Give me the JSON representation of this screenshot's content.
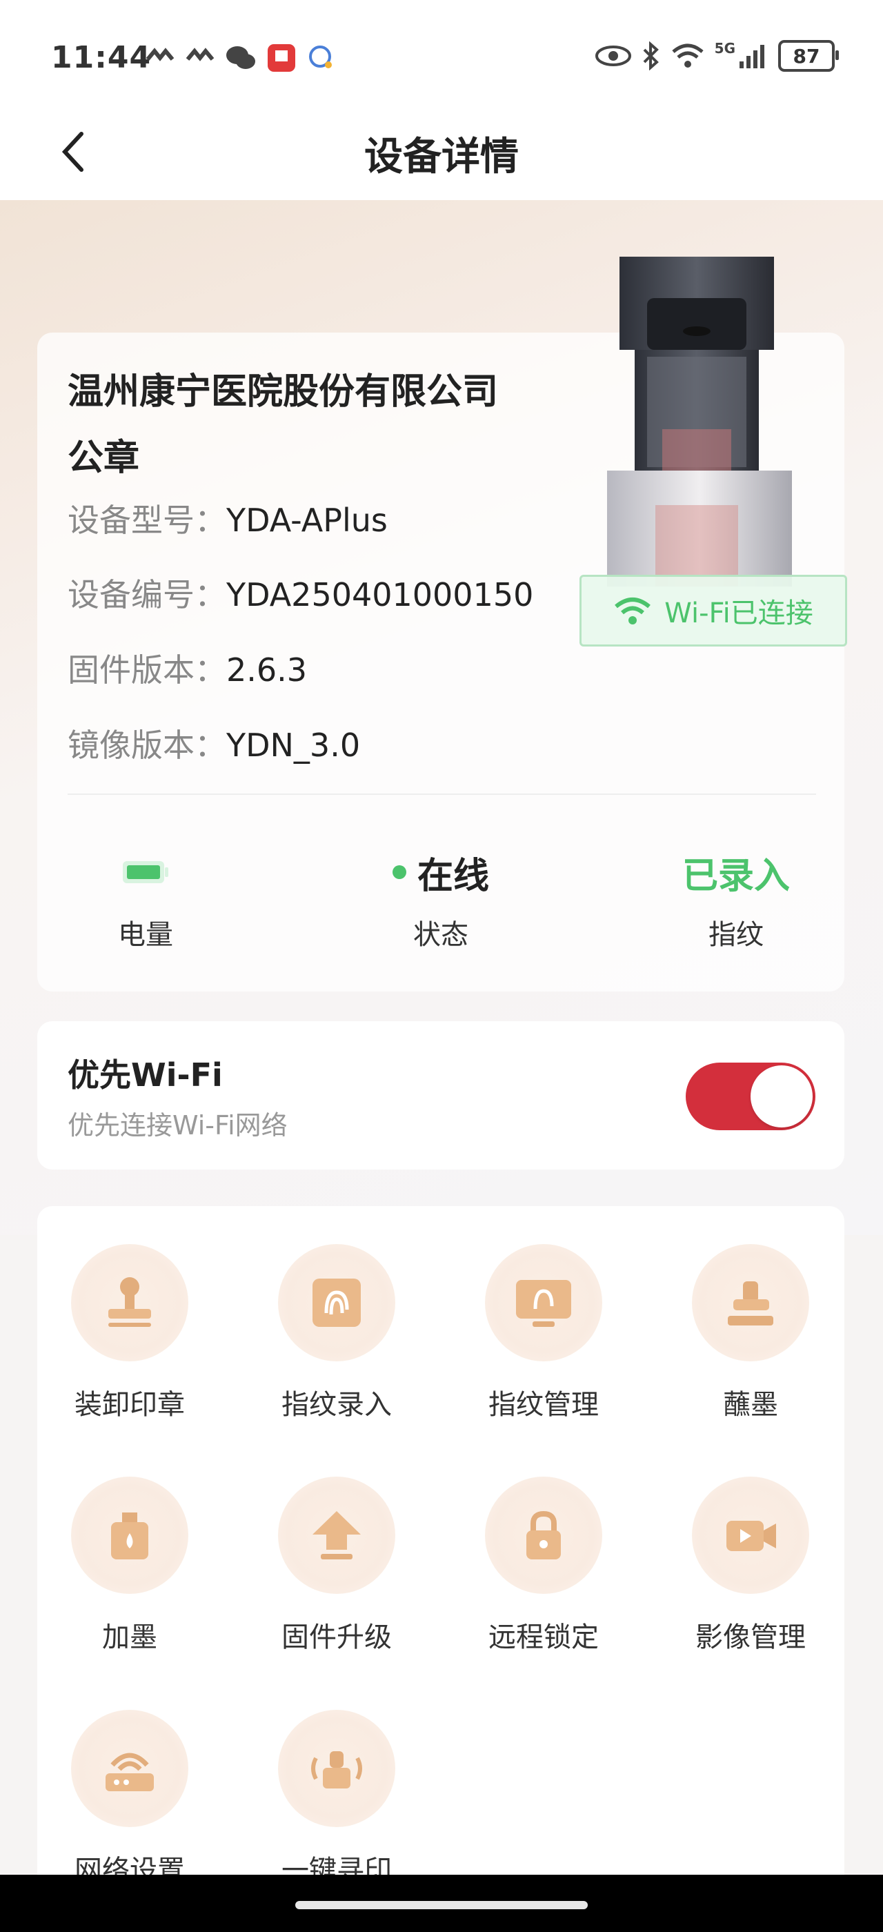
{
  "status_bar": {
    "time": "11:44",
    "battery": "87",
    "network": "5G"
  },
  "header": {
    "title": "设备详情"
  },
  "device": {
    "name": "温州康宁医院股份有限公司公章",
    "rows": [
      {
        "label": "设备型号：",
        "value": "YDA-APlus"
      },
      {
        "label": "设备编号：",
        "value": "YDA250401000150"
      },
      {
        "label": "固件版本：",
        "value": "2.6.3"
      },
      {
        "label": "镜像版本：",
        "value": "YDN_3.0"
      }
    ],
    "wifi_tag": "Wi-Fi已连接"
  },
  "stats": {
    "battery_label": "电量",
    "status_value": "在线",
    "status_label": "状态",
    "fingerprint_value": "已录入",
    "fingerprint_label": "指纹"
  },
  "preference": {
    "title": "优先Wi-Fi",
    "subtitle": "优先连接Wi-Fi网络",
    "enabled": true
  },
  "actions": [
    {
      "label": "装卸印章",
      "icon": "stamp-icon"
    },
    {
      "label": "指纹录入",
      "icon": "fingerprint-scan-icon"
    },
    {
      "label": "指纹管理",
      "icon": "fingerprint-manage-icon"
    },
    {
      "label": "蘸墨",
      "icon": "ink-dip-icon"
    },
    {
      "label": "加墨",
      "icon": "add-ink-icon"
    },
    {
      "label": "固件升级",
      "icon": "upgrade-icon"
    },
    {
      "label": "远程锁定",
      "icon": "lock-icon"
    },
    {
      "label": "影像管理",
      "icon": "video-icon"
    },
    {
      "label": "网络设置",
      "icon": "router-icon"
    },
    {
      "label": "一键寻印",
      "icon": "locate-stamp-icon"
    }
  ],
  "colors": {
    "accent": "#d32f3c",
    "online": "#4cc36c",
    "icon": "#e8b98a"
  }
}
